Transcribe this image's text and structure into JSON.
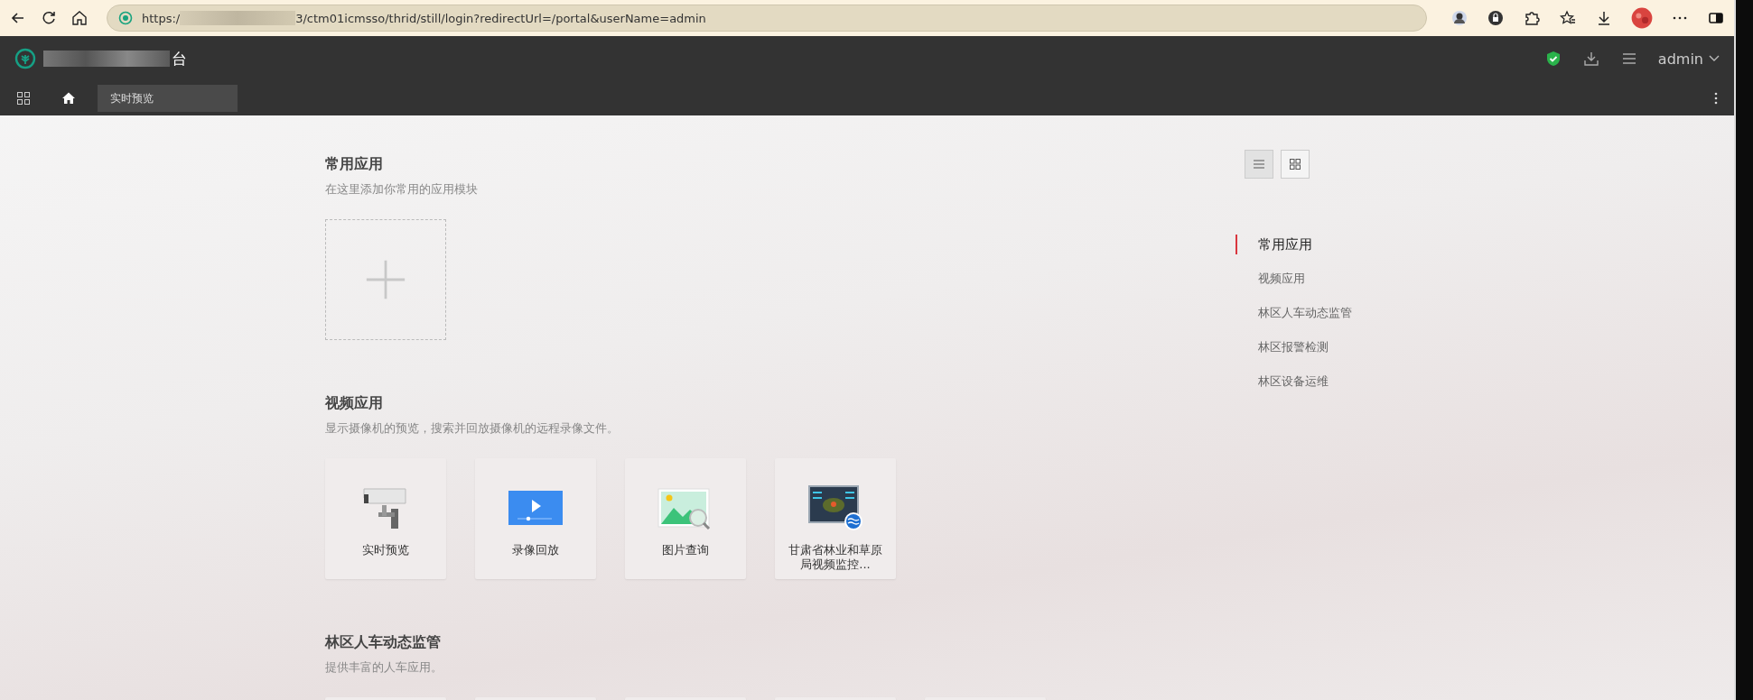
{
  "browser": {
    "url_start": "https:/",
    "url_end": "3/ctm01icmsso/thrid/still/login?redirectUrl=/portal&userName=admin"
  },
  "header": {
    "title_visible": "台",
    "user": "admin"
  },
  "nav": {
    "tab": "实时预览"
  },
  "view_toggle": [
    {
      "kind": "list",
      "selected": true
    },
    {
      "kind": "grid",
      "selected": false
    }
  ],
  "sections": [
    {
      "title": "常用应用",
      "subtitle": "在这里添加你常用的应用模块",
      "kind": "add"
    },
    {
      "title": "视频应用",
      "subtitle": "显示摄像机的预览，搜索并回放摄像机的远程录像文件。",
      "kind": "apps",
      "apps": [
        {
          "label": "实时预览",
          "kind": "camera"
        },
        {
          "label": "录像回放",
          "kind": "player"
        },
        {
          "label": "图片查询",
          "kind": "image"
        },
        {
          "label": "甘肃省林业和草原局视频监控...",
          "kind": "dashboard"
        }
      ]
    },
    {
      "title": "林区人车动态监管",
      "subtitle": "提供丰富的人车应用。",
      "kind": "apps",
      "apps": [
        {
          "kind": "blank"
        },
        {
          "kind": "blank"
        },
        {
          "kind": "blank"
        },
        {
          "kind": "blank"
        },
        {
          "kind": "blank"
        }
      ]
    }
  ],
  "toc": [
    {
      "label": "常用应用",
      "selected": true
    },
    {
      "label": "视频应用",
      "selected": false
    },
    {
      "label": "林区人车动态监管",
      "selected": false
    },
    {
      "label": "林区报警检测",
      "selected": false
    },
    {
      "label": "林区设备运维",
      "selected": false
    }
  ]
}
